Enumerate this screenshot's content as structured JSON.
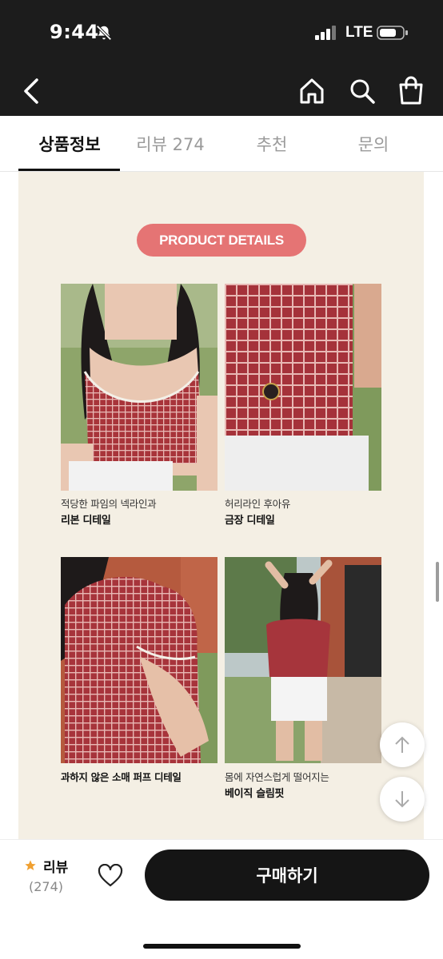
{
  "status_bar": {
    "time": "9:44",
    "network": "LTE"
  },
  "header": {
    "back_icon": "chevron-left-icon",
    "home_icon": "home-icon",
    "search_icon": "search-icon",
    "bag_icon": "shopping-bag-icon"
  },
  "tabs": [
    {
      "label": "상품정보",
      "active": true
    },
    {
      "label": "리뷰 274",
      "active": false
    },
    {
      "label": "추천",
      "active": false
    },
    {
      "label": "문의",
      "active": false
    }
  ],
  "section": {
    "badge": "PRODUCT DETAILS"
  },
  "details": [
    {
      "line1": "적당한 파임의 넥라인과",
      "line2": "리본 디테일"
    },
    {
      "line1": "허리라인 후아유",
      "line2": "금장 디테일"
    },
    {
      "line1": "과하지 않은 소매 퍼프 디테일",
      "line2": ""
    },
    {
      "line1": "몸에 자연스럽게 떨어지는",
      "line2": "베이직 슬림핏"
    }
  ],
  "float_buttons": {
    "up_icon": "arrow-up-icon",
    "down_icon": "arrow-down-icon"
  },
  "bottom_bar": {
    "review_label": "리뷰",
    "review_count": "(274)",
    "buy_label": "구매하기"
  },
  "colors": {
    "header_bg": "#1c1c1c",
    "badge_bg": "#e57474",
    "panel_bg": "#f4efe4",
    "buy_bg": "#151515",
    "star": "#f0a030"
  }
}
